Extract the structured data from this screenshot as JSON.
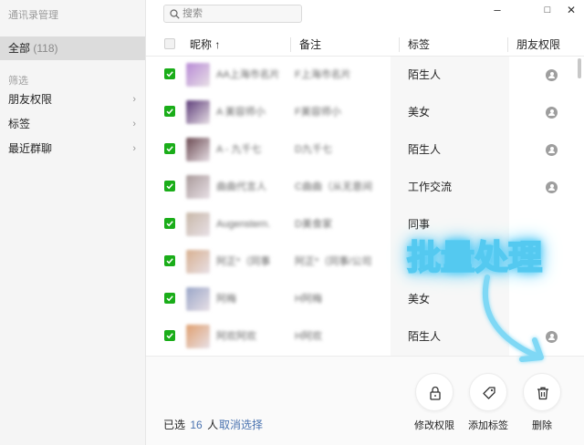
{
  "sidebar": {
    "app_title": "通讯录管理",
    "all_label": "全部",
    "all_count": "(118)",
    "section_label": "筛选",
    "items": [
      {
        "label": "朋友权限",
        "chevron": "›"
      },
      {
        "label": "标签",
        "chevron": "›"
      },
      {
        "label": "最近群聊",
        "chevron": "›"
      }
    ]
  },
  "search": {
    "placeholder": "搜索"
  },
  "window": {
    "minimize": "–",
    "maximize": "□",
    "close": "✕"
  },
  "table": {
    "columns": {
      "nickname": "昵称 ↑",
      "remark": "备注",
      "tags": "标签",
      "permission": "朋友权限"
    },
    "rows": [
      {
        "nickname": "AA上海市名片",
        "remark": "F上海市名片",
        "tag": "陌生人",
        "has_perm_icon": true,
        "avatar_color": "#b88ad6"
      },
      {
        "nickname": "A 美容师小",
        "remark": "F美容师小",
        "tag": "美女",
        "has_perm_icon": true,
        "avatar_color": "#5e3d7a"
      },
      {
        "nickname": "A - 九千七",
        "remark": "D九千七",
        "tag": "陌生人",
        "has_perm_icon": true,
        "avatar_color": "#6b4a52"
      },
      {
        "nickname": "曲曲代言人",
        "remark": "C曲曲（从无意间",
        "tag": "工作交流",
        "has_perm_icon": true,
        "avatar_color": "#a99a9a"
      },
      {
        "nickname": "Augenstern.",
        "remark": "D美食家",
        "tag": "同事",
        "has_perm_icon": false,
        "avatar_color": "#c8b8a8"
      },
      {
        "nickname": "阿正*（同事",
        "remark": "阿正*（同事/公司",
        "tag": "",
        "has_perm_icon": false,
        "avatar_color": "#d8b090"
      },
      {
        "nickname": "阿梅",
        "remark": "H阿梅",
        "tag": "美女",
        "has_perm_icon": false,
        "avatar_color": "#9aa6c8"
      },
      {
        "nickname": "阿欢阿欢",
        "remark": "H阿欢",
        "tag": "陌生人",
        "has_perm_icon": true,
        "avatar_color": "#e0a070"
      }
    ]
  },
  "footer": {
    "selected_prefix": "已选",
    "selected_count": "16",
    "selected_suffix": "人",
    "deselect_label": "取消选择",
    "actions": [
      {
        "label": "修改权限",
        "icon": "lock-icon"
      },
      {
        "label": "添加标签",
        "icon": "tag-icon"
      },
      {
        "label": "删除",
        "icon": "trash-icon"
      }
    ]
  },
  "annotation": {
    "text": "批量处理",
    "color": "#54c9f0"
  },
  "colors": {
    "check_green": "#1aad19",
    "link_blue": "#4a73b0",
    "sidebar_bg": "#f5f5f5",
    "selected_bg": "#dcdcdc"
  }
}
